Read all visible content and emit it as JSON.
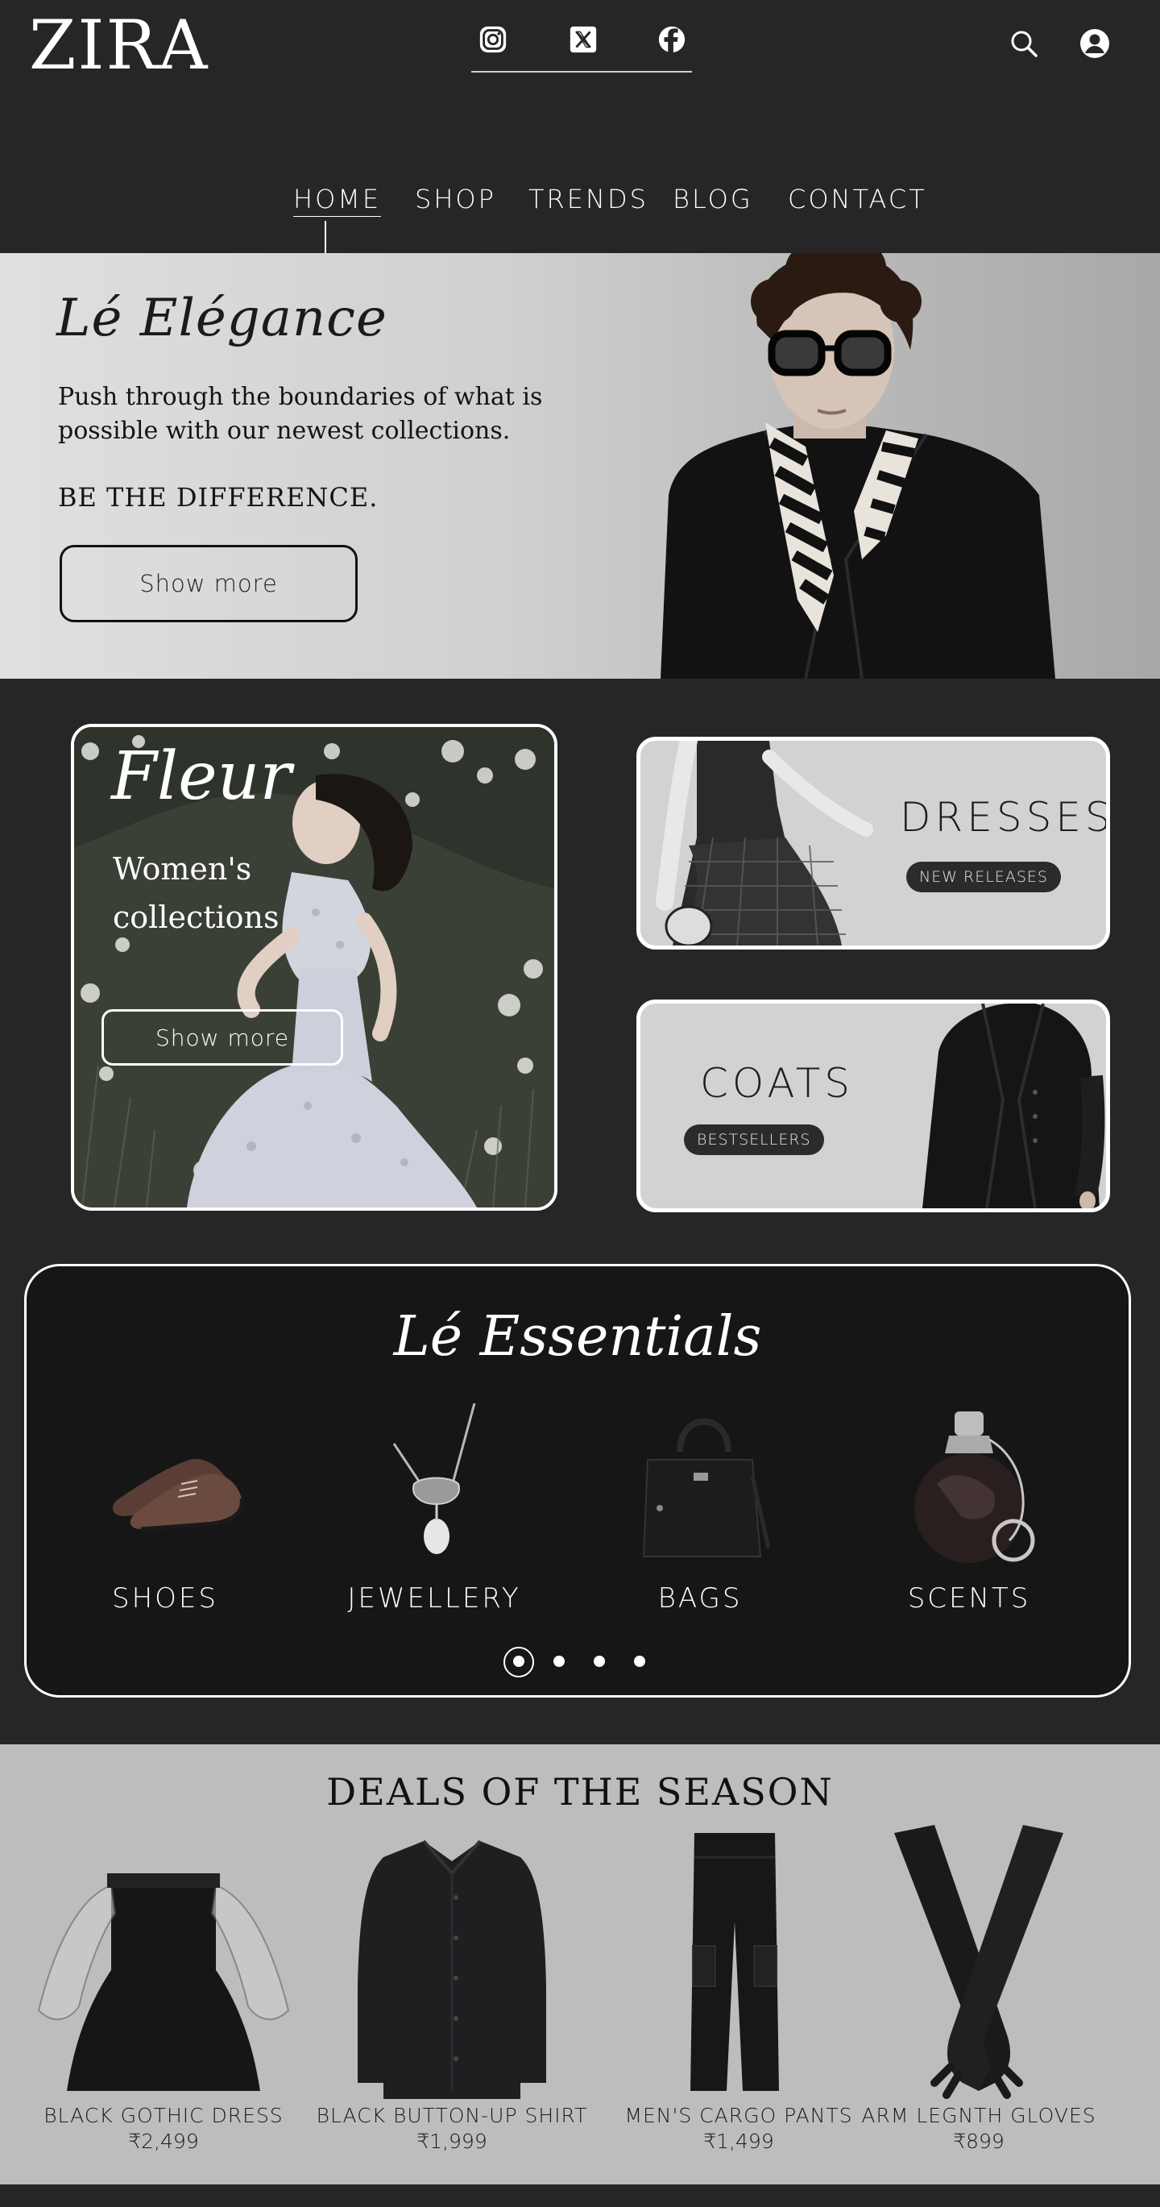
{
  "brand": {
    "logo": "ZIRA"
  },
  "header": {
    "social": [
      "instagram-icon",
      "x-icon",
      "facebook-icon"
    ],
    "actions": [
      "search-icon",
      "user-icon"
    ]
  },
  "nav": {
    "items": [
      {
        "label": "HOME",
        "active": true
      },
      {
        "label": "SHOP"
      },
      {
        "label": "TRENDS"
      },
      {
        "label": "BLOG"
      },
      {
        "label": "CONTACT"
      }
    ]
  },
  "hero": {
    "script_title": "Lé Elégance",
    "text": "Push through the boundaries of what is possible with our newest collections.",
    "tagline": "BE THE DIFFERENCE.",
    "button_label": "Show more"
  },
  "fleur": {
    "title": "Fleur",
    "subtitle": "Women's collections",
    "button_label": "Show more"
  },
  "categories": [
    {
      "name": "DRESSES",
      "badge": "NEW RELEASES"
    },
    {
      "name": "COATS",
      "badge": "BESTSELLERS"
    }
  ],
  "essentials": {
    "title": "Lé Essentials",
    "items": [
      {
        "label": "SHOES",
        "icon": "shoes-image"
      },
      {
        "label": "JEWELLERY",
        "icon": "necklace-image"
      },
      {
        "label": "BAGS",
        "icon": "bag-image"
      },
      {
        "label": "SCENTS",
        "icon": "perfume-image"
      }
    ],
    "carousel": {
      "pages": 4,
      "current": 1
    }
  },
  "deals": {
    "title": "DEALS OF THE SEASON",
    "items": [
      {
        "name": "BLACK GOTHIC DRESS",
        "price": "₹2,499"
      },
      {
        "name": "BLACK BUTTON-UP SHIRT",
        "price": "₹1,999"
      },
      {
        "name": "MEN'S CARGO PANTS",
        "price": "₹1,499"
      },
      {
        "name": "ARM LEGNTH GLOVES",
        "price": "₹899"
      }
    ]
  },
  "colors": {
    "background": "#262626",
    "hero": "#d0d0d0",
    "deals": "#bdbdbd",
    "essentials": "#161616"
  }
}
